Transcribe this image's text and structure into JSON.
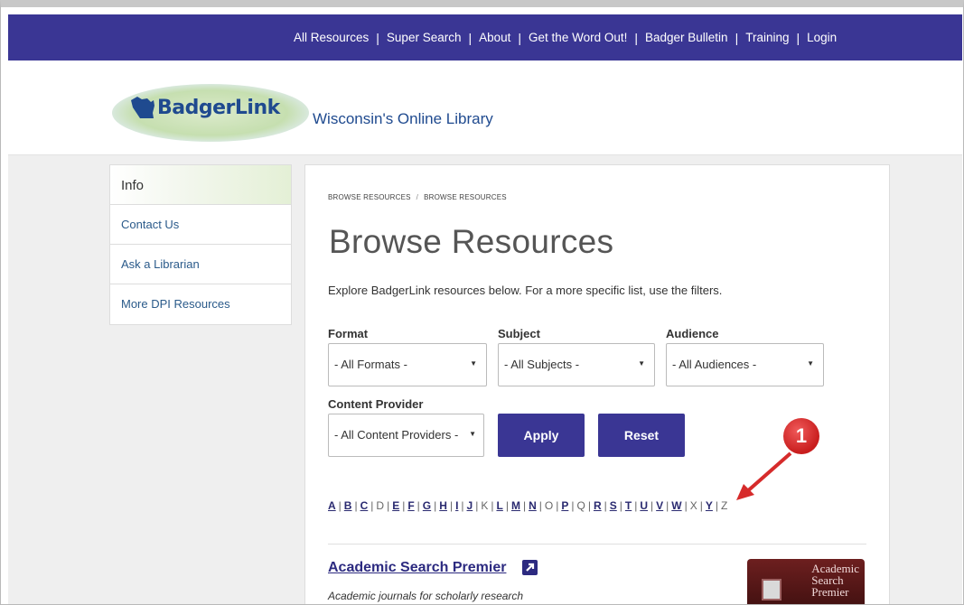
{
  "topnav": {
    "items": [
      "All Resources",
      "Super Search",
      "About",
      "Get the Word Out!",
      "Badger Bulletin",
      "Training",
      "Login"
    ]
  },
  "header": {
    "logo_text": "BadgerLink",
    "tagline": "Wisconsin's Online Library"
  },
  "sidebar": {
    "heading": "Info",
    "items": [
      "Contact Us",
      "Ask a Librarian",
      "More DPI Resources"
    ]
  },
  "main": {
    "breadcrumbs": [
      "BROWSE RESOURCES",
      "BROWSE RESOURCES"
    ],
    "title": "Browse Resources",
    "description": "Explore BadgerLink resources below. For a more specific list, use the filters.",
    "filters": {
      "format_label": "Format",
      "format_value": "- All Formats -",
      "subject_label": "Subject",
      "subject_value": "- All Subjects -",
      "audience_label": "Audience",
      "audience_value": "- All Audiences -",
      "provider_label": "Content Provider",
      "provider_value": "- All Content Providers -"
    },
    "apply_label": "Apply",
    "reset_label": "Reset",
    "alphabet": {
      "letters": [
        "A",
        "B",
        "C",
        "D",
        "E",
        "F",
        "G",
        "H",
        "I",
        "J",
        "K",
        "L",
        "M",
        "N",
        "O",
        "P",
        "Q",
        "R",
        "S",
        "T",
        "U",
        "V",
        "W",
        "X",
        "Y",
        "Z"
      ],
      "linked": [
        "A",
        "B",
        "C",
        "E",
        "F",
        "G",
        "H",
        "I",
        "J",
        "L",
        "M",
        "N",
        "P",
        "R",
        "S",
        "T",
        "U",
        "V",
        "W",
        "Y"
      ]
    },
    "resource": {
      "title": "Academic Search Premier",
      "description": "Academic journals for scholarly research",
      "thumb_line1": "Academic",
      "thumb_line2": "Search",
      "thumb_line3": "Premier"
    }
  },
  "annotation": {
    "number": "1"
  },
  "colors": {
    "nav_bg": "#3a3694",
    "button_bg": "#3a3694",
    "annotation": "#d62b2b"
  }
}
